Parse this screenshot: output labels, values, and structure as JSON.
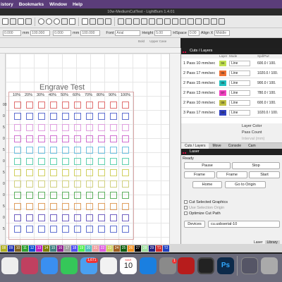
{
  "menubar": {
    "items": [
      "istory",
      "Bookmarks",
      "Window",
      "Help"
    ]
  },
  "window": {
    "title": "10w-MediumCutTest - LightBurn 1.4.01"
  },
  "toolbar2": {
    "x_value": "0.000",
    "x_unit": "mm",
    "y_value": "0.000",
    "y_unit": "mm",
    "w_percent": "100.000",
    "h_percent": "100.000",
    "font_label": "Font",
    "font_value": "Arial",
    "height_label": "Height",
    "height_value": "5.00",
    "hspace_label": "HSpace",
    "hspace_value": "0.00",
    "vspace_label": "VSpace",
    "vspace_value": "0.00",
    "alignx_label": "Align X",
    "alignx_value": "Middle",
    "aligny_label": "Align Y",
    "aligny_value": "Top",
    "bold": "Bold",
    "italic": "Italic",
    "upper_case": "Upper Case",
    "welded": "Welded",
    "distort": "Distort"
  },
  "canvas": {
    "title": "Engrave Test",
    "percents": [
      "10%",
      "20%",
      "30%",
      "40%",
      "50%",
      "60%",
      "70%",
      "80%",
      "90%",
      "100%"
    ],
    "row_labels": [
      "00",
      "0",
      "5",
      "0",
      "5",
      "0",
      "5",
      "0",
      "0",
      "5",
      "0",
      "5"
    ]
  },
  "cuts_layers": {
    "header": "Cuts / Layers",
    "columns": {
      "layer": "Layer",
      "mode": "Mode",
      "speed": "Spd/Pwr"
    },
    "rows": [
      {
        "name": "1 Pass 10 mm/sec",
        "layer": "04",
        "color": "#c0e050",
        "mode": "Line",
        "speed": "600.0 / 100."
      },
      {
        "name": "2 Pass 17 mm/sec",
        "layer": "06",
        "color": "#f07030",
        "mode": "Line",
        "speed": "1020.0 / 100."
      },
      {
        "name": "2 Pass 15 mm/sec",
        "layer": "05",
        "color": "#20c0c0",
        "mode": "Line",
        "speed": "900.0 / 100."
      },
      {
        "name": "2 Pass 13 mm/sec",
        "layer": "07",
        "color": "#f040c0",
        "mode": "Line",
        "speed": "780.0 / 100."
      },
      {
        "name": "2 Pass 10 mm/sec",
        "layer": "08",
        "color": "#c0c040",
        "mode": "Line",
        "speed": "600.0 / 100."
      },
      {
        "name": "3 Pass 17 mm/sec",
        "layer": "09",
        "color": "#3040c0",
        "mode": "Line",
        "speed": "1020.0 / 100."
      }
    ],
    "layer_color_label": "Layer Color",
    "pass_count_label": "Pass Count",
    "interval_label": "Interval (mm)"
  },
  "panel_tabs": [
    "Cuts / Layers",
    "Move",
    "Console",
    "Cam"
  ],
  "laser": {
    "header": "Laser",
    "status": "Ready",
    "pause": "Pause",
    "stop": "Stop",
    "frame1": "Frame",
    "frame2": "Frame",
    "start": "Start",
    "home": "Home",
    "go_to_origin": "Go to Origin",
    "cut_selected": "Cut Selected Graphics",
    "use_selection_origin": "Use Selection Origin",
    "optimize_cut_path": "Optimize Cut Path",
    "devices": "Devices",
    "device_value": "cu.usbserial-10"
  },
  "laser_tabs": [
    "Laser",
    "Library"
  ],
  "palette": [
    {
      "label": "08",
      "color": "#b0b020"
    },
    {
      "label": "09",
      "color": "#2030b0"
    },
    {
      "label": "10",
      "color": "#806020"
    },
    {
      "label": "11",
      "color": "#30a030"
    },
    {
      "label": "12",
      "color": "#1050d0"
    },
    {
      "label": "13",
      "color": "#c020c0"
    },
    {
      "label": "14",
      "color": "#808000"
    },
    {
      "label": "15",
      "color": "#408080"
    },
    {
      "label": "16",
      "color": "#902090"
    },
    {
      "label": "17",
      "color": "#a0a0a0"
    },
    {
      "label": "18",
      "color": "#5050f0"
    },
    {
      "label": "19",
      "color": "#50f050"
    },
    {
      "label": "20",
      "color": "#50c0c0"
    },
    {
      "label": "21",
      "color": "#f0a0a0"
    },
    {
      "label": "22",
      "color": "#e060e0"
    },
    {
      "label": "23",
      "color": "#d0d060"
    },
    {
      "label": "24",
      "color": "#a06020"
    },
    {
      "label": "25",
      "color": "#106010"
    },
    {
      "label": "26",
      "color": "#f09020"
    },
    {
      "label": "27",
      "color": "#000000"
    },
    {
      "label": "28",
      "color": "#a0e0a0"
    },
    {
      "label": "29",
      "color": "#202080"
    },
    {
      "label": "T1",
      "color": "#d03030"
    },
    {
      "label": "T2",
      "color": "#2040c0"
    }
  ],
  "dock": {
    "mail_badge": "1,671",
    "calendar_day": "10",
    "calendar_month": "MAR",
    "settings_badge": "1"
  }
}
